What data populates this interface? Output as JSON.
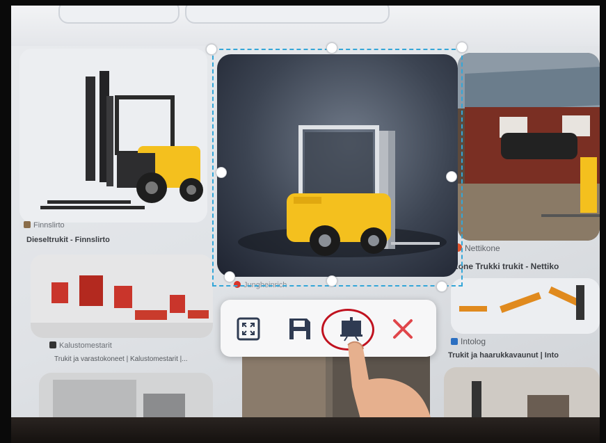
{
  "results": [
    {
      "source": "Finnslirto",
      "title": "Dieseltrukit - Finnslirto"
    },
    {
      "source": "Jungheinrich",
      "title": ""
    },
    {
      "source": "Nettikone",
      "title": "Kone Trukki trukit - Nettiko"
    },
    {
      "source": "Kalustomestarit",
      "title": "Trukit ja varastokoneet | Kalustomestarit |..."
    },
    {
      "source": "Intolog",
      "title": "Trukit ja haarukkavaunut | Into"
    }
  ],
  "toolbar": {
    "fullscreen_icon": "fullscreen-icon",
    "save_icon": "save-icon",
    "presentation_icon": "presentation-board-icon",
    "close_icon": "close-x-icon"
  },
  "colors": {
    "selection": "#33a6d8",
    "highlight_circle": "#c0121f",
    "close_red": "#e0464b",
    "forklift_yellow": "#f4c01e"
  }
}
